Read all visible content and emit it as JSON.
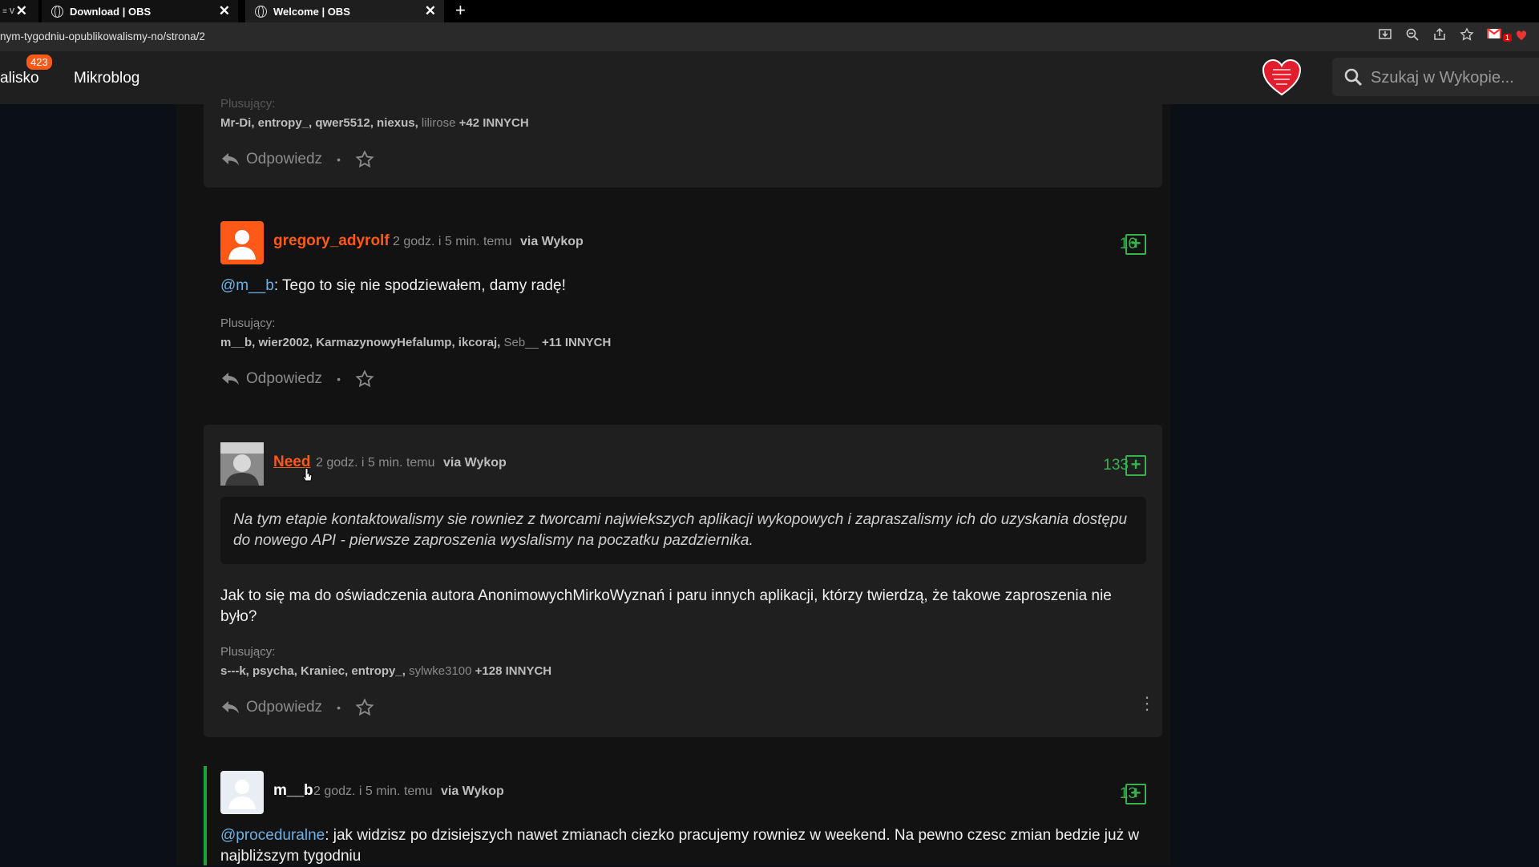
{
  "browser": {
    "tabs": [
      {
        "label": "≡ V",
        "active": false
      },
      {
        "label": "Download | OBS",
        "active": false
      },
      {
        "label": "Welcome | OBS",
        "active": true
      }
    ],
    "close_glyph": "✕",
    "new_tab_glyph": "+",
    "url": "nym-tygodniu-opublikowalismy-no/strona/2",
    "toolbar_icons": [
      "install-icon",
      "zoom-icon",
      "share-icon",
      "bookmark-star-icon",
      "gmail-icon"
    ],
    "mail_badge": "1"
  },
  "header": {
    "nav_wykopalisko": "alisko",
    "nav_badge": "423",
    "nav_mikroblog": "Mikroblog",
    "search_placeholder": "Szukaj w Wykopie...",
    "accent": "#ff5917"
  },
  "comments": [
    {
      "plus_label": "Plusujący:",
      "plus_bold": "Mr-Di, entropy_, qwer5512, niexus,",
      "plus_muted": "lilirose",
      "plus_more": "+42 INNYCH",
      "reply_label": "Odpowiedz"
    },
    {
      "username": "gregory_adyrolf",
      "time": "2 godz. i 5 min. temu",
      "via": "via Wykop",
      "votes": "16",
      "mention": "@m__b",
      "text": ": Tego to się nie spodziewałem, damy radę!",
      "plus_label": "Plusujący:",
      "plus_bold": "m__b, wier2002, KarmazynowyHefalump, ikcoraj,",
      "plus_muted": "Seb__",
      "plus_more": "+11 INNYCH",
      "reply_label": "Odpowiedz"
    },
    {
      "username": "Need",
      "time": "2 godz. i 5 min. temu",
      "via": "via Wykop",
      "votes": "133",
      "quote": "Na tym etapie kontaktowalismy sie rowniez z tworcami najwiekszych aplikacji wykopowych i zapraszalismy ich do uzyskania dostępu do nowego API - pierwsze zaproszenia wyslalismy na poczatku pazdziernika.",
      "text": "Jak to się ma do oświadczenia autora AnonimowychMirkoWyznań i paru innych aplikacji, którzy twierdzą, że takowe zaproszenia nie było?",
      "plus_label": "Plusujący:",
      "plus_bold": "s---k, psycha, Kraniec, entropy_,",
      "plus_muted": "sylwke3100",
      "plus_more": "+128 INNYCH",
      "reply_label": "Odpowiedz"
    },
    {
      "username": "m__b",
      "time": "2 godz. i 5 min. temu",
      "via": "via Wykop",
      "votes": "13",
      "mention": "@proceduralne",
      "text": ": jak widzisz po dzisiejszych nawet zmianach ciezko pracujemy rowniez w weekend. Na pewno czesc zmian bedzie już w najbliższym tygodniu"
    }
  ]
}
